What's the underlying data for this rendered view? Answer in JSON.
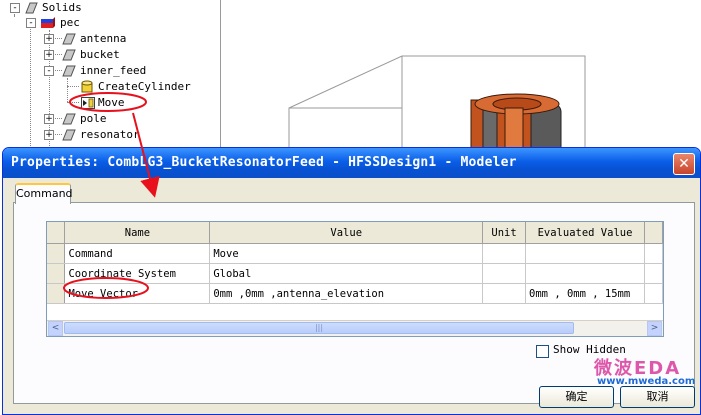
{
  "tree": {
    "items": [
      {
        "label": "Solids",
        "icon": "solid-folder-icon",
        "expander": "-"
      },
      {
        "label": "pec",
        "icon": "material-icon",
        "expander": "-"
      },
      {
        "label": "antenna",
        "icon": "solid-object-icon",
        "expander": "+"
      },
      {
        "label": "bucket",
        "icon": "solid-object-icon",
        "expander": "+"
      },
      {
        "label": "inner_feed",
        "icon": "solid-object-icon",
        "expander": "-"
      },
      {
        "label": "CreateCylinder",
        "icon": "cylinder-icon",
        "expander": ""
      },
      {
        "label": "Move",
        "icon": "move-icon",
        "expander": ""
      },
      {
        "label": "pole",
        "icon": "solid-object-icon",
        "expander": "+"
      },
      {
        "label": "resonator",
        "icon": "solid-object-icon",
        "expander": "+"
      }
    ]
  },
  "dialog": {
    "title": "Properties: CombLG3_BucketResonatorFeed - HFSSDesign1 - Modeler",
    "close_glyph": "✕",
    "tab_label": "Command",
    "table": {
      "columns": [
        "Name",
        "Value",
        "Unit",
        "Evaluated Value"
      ],
      "rows": [
        {
          "name": "Command",
          "value": "Move",
          "unit": "",
          "evaluated": ""
        },
        {
          "name": "Coordinate System",
          "value": "Global",
          "unit": "",
          "evaluated": ""
        },
        {
          "name": "Move Vector",
          "value": "0mm ,0mm ,antenna_elevation",
          "unit": "",
          "evaluated": "0mm , 0mm , 15mm"
        }
      ]
    },
    "scroll_left": "<",
    "scroll_right": ">",
    "scroll_grip": "|||",
    "show_hidden_label": "Show Hidden",
    "ok_label": "确定",
    "cancel_label": "取消"
  },
  "watermark": {
    "brand": "微波EDA",
    "url": "www.mweda.com"
  },
  "colors": {
    "annotation": "#e8101c",
    "title_bar": "#0a5ee8",
    "dialog_bg": "#ece9d8",
    "cylinder_fill": "#c2521e"
  }
}
